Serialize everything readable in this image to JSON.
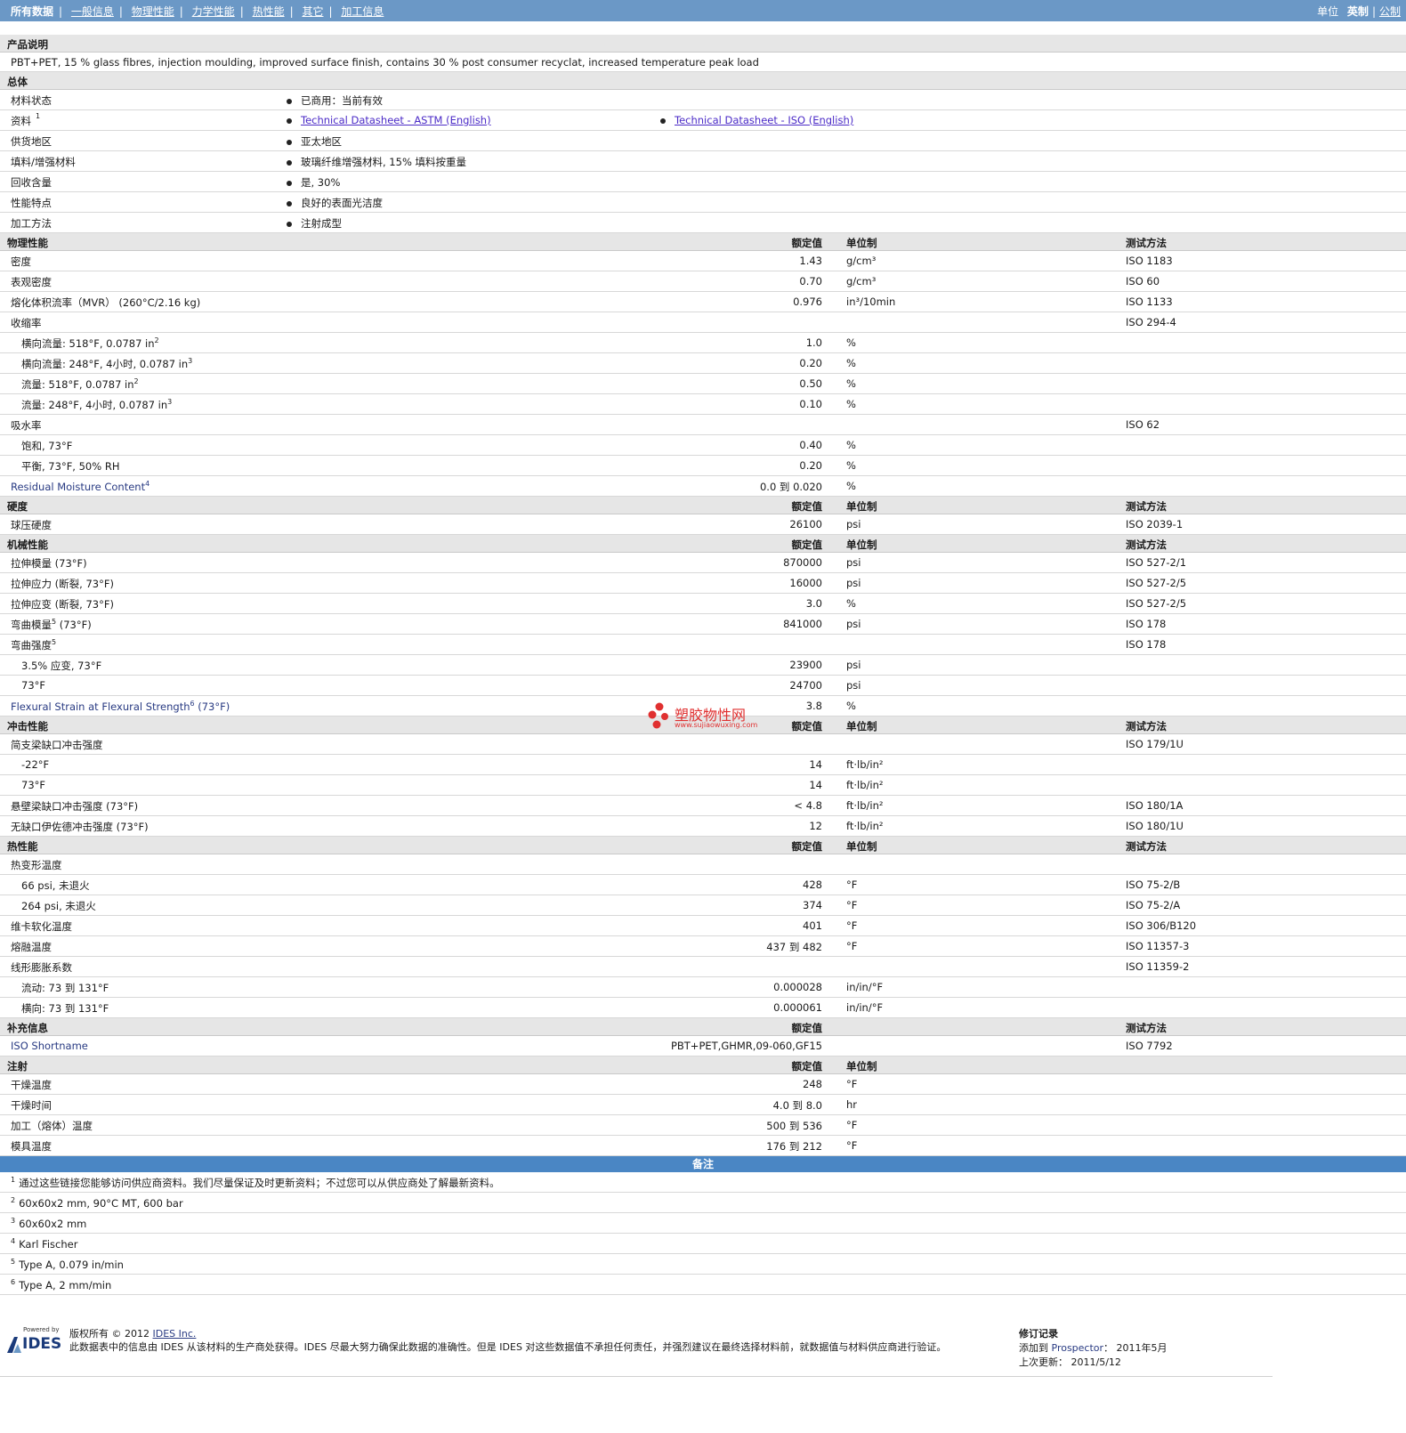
{
  "nav": {
    "items": [
      "所有数据",
      "一般信息",
      "物理性能",
      "力学性能",
      "热性能",
      "其它",
      "加工信息"
    ],
    "units_label": "单位",
    "unit_options": [
      "英制",
      "公制"
    ]
  },
  "product": {
    "header": "产品说明",
    "description": "PBT+PET, 15 % glass fibres, injection moulding, improved surface finish, contains 30 % post consumer recyclat, increased temperature peak load"
  },
  "general": {
    "header": "总体",
    "rows": [
      {
        "label": "材料状态",
        "value": "已商用：当前有效"
      },
      {
        "label": "资料",
        "sup": "1",
        "link1": "Technical Datasheet - ASTM (English)",
        "link2": "Technical Datasheet - ISO (English)"
      },
      {
        "label": "供货地区",
        "value": "亚太地区"
      },
      {
        "label": "填料/增强材料",
        "value": "玻璃纤维增强材料, 15% 填料按重量"
      },
      {
        "label": "回收含量",
        "value": "是, 30%"
      },
      {
        "label": "性能特点",
        "value": "良好的表面光洁度"
      },
      {
        "label": "加工方法",
        "value": "注射成型"
      }
    ]
  },
  "col_headers": {
    "value": "额定值",
    "unit": "单位制",
    "method": "测试方法"
  },
  "physical": {
    "header": "物理性能",
    "rows": [
      {
        "label": "密度",
        "value": "1.43",
        "unit": "g/cm³",
        "method": "ISO 1183"
      },
      {
        "label": "表观密度",
        "value": "0.70",
        "unit": "g/cm³",
        "method": "ISO 60"
      },
      {
        "label": "熔化体积流率（MVR） (260°C/2.16 kg)",
        "value": "0.976",
        "unit": "in³/10min",
        "method": "ISO 1133"
      },
      {
        "label": "收缩率",
        "method": "ISO 294-4"
      },
      {
        "label": "横向流量: 518°F, 0.0787 in",
        "sup": "2",
        "sub": true,
        "value": "1.0",
        "unit": "%"
      },
      {
        "label": "横向流量: 248°F, 4小时, 0.0787 in",
        "sup": "3",
        "sub": true,
        "value": "0.20",
        "unit": "%"
      },
      {
        "label": "流量: 518°F, 0.0787 in",
        "sup": "2",
        "sub": true,
        "value": "0.50",
        "unit": "%"
      },
      {
        "label": "流量: 248°F, 4小时, 0.0787 in",
        "sup": "3",
        "sub": true,
        "value": "0.10",
        "unit": "%"
      },
      {
        "label": "吸水率",
        "method": "ISO 62"
      },
      {
        "label": "饱和, 73°F",
        "sub": true,
        "value": "0.40",
        "unit": "%"
      },
      {
        "label": "平衡, 73°F, 50% RH",
        "sub": true,
        "value": "0.20",
        "unit": "%"
      },
      {
        "label": "Residual Moisture Content",
        "sup": "4",
        "en": true,
        "value": "0.0 到  0.020",
        "unit": "%"
      }
    ]
  },
  "hardness": {
    "header": "硬度",
    "rows": [
      {
        "label": "球压硬度",
        "value": "26100",
        "unit": "psi",
        "method": "ISO 2039-1"
      }
    ]
  },
  "mechanical": {
    "header": "机械性能",
    "rows": [
      {
        "label": "拉伸模量 (73°F)",
        "value": "870000",
        "unit": "psi",
        "method": "ISO 527-2/1"
      },
      {
        "label": "拉伸应力 (断裂, 73°F)",
        "value": "16000",
        "unit": "psi",
        "method": "ISO 527-2/5"
      },
      {
        "label": "拉伸应变 (断裂, 73°F)",
        "value": "3.0",
        "unit": "%",
        "method": "ISO 527-2/5"
      },
      {
        "label": "弯曲模量",
        "sup": "5",
        "after": " (73°F)",
        "value": "841000",
        "unit": "psi",
        "method": "ISO 178"
      },
      {
        "label": "弯曲强度",
        "sup": "5",
        "method": "ISO 178"
      },
      {
        "label": "3.5% 应变, 73°F",
        "sub": true,
        "value": "23900",
        "unit": "psi"
      },
      {
        "label": "73°F",
        "sub": true,
        "value": "24700",
        "unit": "psi"
      },
      {
        "label": "Flexural Strain at Flexural Strength",
        "sup": "6",
        "after": " (73°F)",
        "en": true,
        "value": "3.8",
        "unit": "%"
      }
    ]
  },
  "impact": {
    "header": "冲击性能",
    "rows": [
      {
        "label": "简支梁缺口冲击强度",
        "method": "ISO 179/1U"
      },
      {
        "label": "-22°F",
        "sub": true,
        "value": "14",
        "unit": "ft·lb/in²"
      },
      {
        "label": "73°F",
        "sub": true,
        "value": "14",
        "unit": "ft·lb/in²"
      },
      {
        "label": "悬壁梁缺口冲击强度 (73°F)",
        "value": "< 4.8",
        "unit": "ft·lb/in²",
        "method": "ISO 180/1A"
      },
      {
        "label": "无缺口伊佐德冲击强度 (73°F)",
        "value": "12",
        "unit": "ft·lb/in²",
        "method": "ISO 180/1U"
      }
    ]
  },
  "thermal": {
    "header": "热性能",
    "rows": [
      {
        "label": "热变形温度"
      },
      {
        "label": "66 psi, 未退火",
        "sub": true,
        "value": "428",
        "unit": "°F",
        "method": "ISO 75-2/B"
      },
      {
        "label": "264 psi, 未退火",
        "sub": true,
        "value": "374",
        "unit": "°F",
        "method": "ISO 75-2/A"
      },
      {
        "label": "维卡软化温度",
        "value": "401",
        "unit": "°F",
        "method": "ISO 306/B120"
      },
      {
        "label": "熔融温度",
        "value": "437 到  482",
        "unit": "°F",
        "method": "ISO 11357-3"
      },
      {
        "label": "线形膨胀系数",
        "method": "ISO 11359-2"
      },
      {
        "label": "流动: 73 到  131°F",
        "sub": true,
        "value": "0.000028",
        "unit": "in/in/°F"
      },
      {
        "label": "横向: 73 到  131°F",
        "sub": true,
        "value": "0.000061",
        "unit": "in/in/°F"
      }
    ]
  },
  "supplement": {
    "header": "补充信息",
    "rows": [
      {
        "label": "ISO Shortname",
        "en": true,
        "value": "PBT+PET,GHMR,09-060,GF15",
        "method": "ISO 7792"
      }
    ]
  },
  "injection": {
    "header": "注射",
    "rows": [
      {
        "label": "干燥温度",
        "value": "248",
        "unit": "°F"
      },
      {
        "label": "干燥时间",
        "value": "4.0 到  8.0",
        "unit": "hr"
      },
      {
        "label": "加工（熔体）温度",
        "value": "500 到  536",
        "unit": "°F"
      },
      {
        "label": "模具温度",
        "value": "176 到  212",
        "unit": "°F"
      }
    ]
  },
  "notes": {
    "header": "备注",
    "items": [
      {
        "num": "1",
        "text": "通过这些链接您能够访问供应商资料。我们尽量保证及时更新资料；不过您可以从供应商处了解最新资料。"
      },
      {
        "num": "2",
        "text": "60x60x2 mm, 90°C MT, 600 bar"
      },
      {
        "num": "3",
        "text": "60x60x2 mm"
      },
      {
        "num": "4",
        "text": "Karl Fischer"
      },
      {
        "num": "5",
        "text": "Type A, 0.079 in/min"
      },
      {
        "num": "6",
        "text": "Type A, 2 mm/min"
      }
    ]
  },
  "footer": {
    "powered_by": "Powered by",
    "logo_text": "IDES",
    "copyright": "版权所有 © 2012",
    "company": "IDES Inc.",
    "disclaimer": "此数据表中的信息由 IDES 从该材料的生产商处获得。IDES 尽最大努力确保此数据的准确性。但是 IDES 对这些数据值不承担任何责任，并强烈建议在最终选择材料前，就数据值与材料供应商进行验证。",
    "revision_title": "修订记录",
    "added_label": "添加到",
    "added_source": "Prospector",
    "added_date": "2011年5月",
    "updated_label": "上次更新：",
    "updated_date": "2011/5/12"
  },
  "watermark": {
    "line1": "塑胶物性网",
    "line2": "www.sujiaowuxing.com",
    "color": "#e03030"
  }
}
